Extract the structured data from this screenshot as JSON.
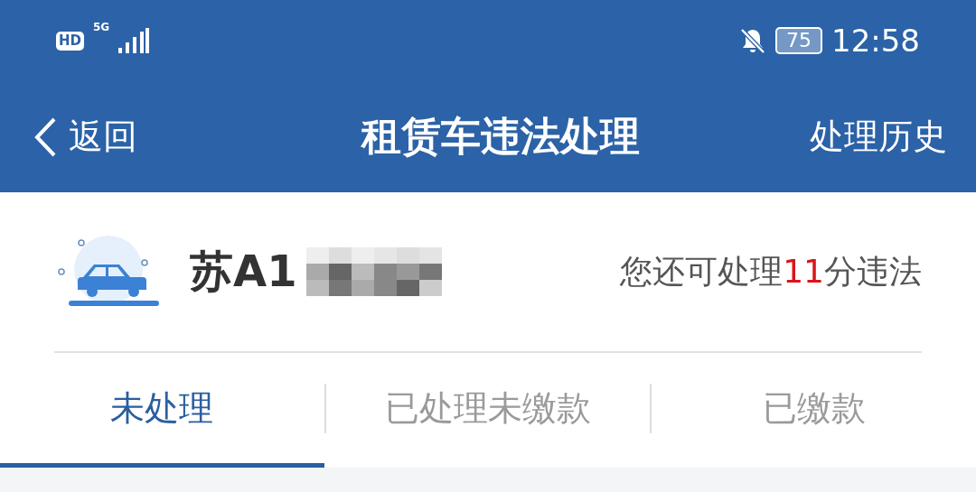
{
  "status_bar": {
    "hd": "HD",
    "network": "5G",
    "battery": "75",
    "time": "12:58"
  },
  "nav": {
    "back": "返回",
    "title": "租赁车违法处理",
    "action": "处理历史"
  },
  "vehicle": {
    "plate": "苏A1",
    "remaining": {
      "before": "您还可处理",
      "count": "11",
      "after": "分违法"
    }
  },
  "tabs": [
    {
      "label": "未处理",
      "selected": true
    },
    {
      "label": "已处理未缴款",
      "selected": false
    },
    {
      "label": "已缴款",
      "selected": false
    }
  ]
}
